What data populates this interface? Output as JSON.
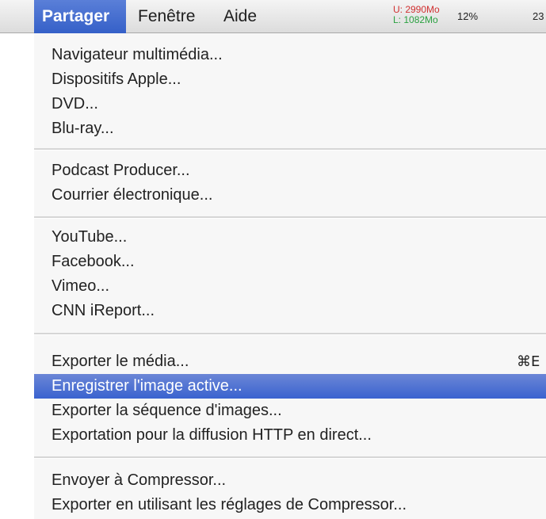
{
  "menubar": {
    "items": [
      {
        "label": "Partager",
        "active": true
      },
      {
        "label": "Fenêtre"
      },
      {
        "label": "Aide"
      }
    ],
    "memory_used": "U: 2990Mo",
    "memory_free": "L: 1082Mo",
    "cpu": "12%",
    "clipped_status": "23"
  },
  "menu": {
    "groups": [
      {
        "items": [
          {
            "label": "Navigateur multimédia..."
          },
          {
            "label": "Dispositifs Apple..."
          },
          {
            "label": "DVD..."
          },
          {
            "label": "Blu-ray..."
          }
        ]
      },
      {
        "items": [
          {
            "label": "Podcast Producer..."
          },
          {
            "label": "Courrier électronique..."
          }
        ]
      },
      {
        "items": [
          {
            "label": "YouTube..."
          },
          {
            "label": "Facebook..."
          },
          {
            "label": "Vimeo..."
          },
          {
            "label": "CNN iReport..."
          }
        ]
      },
      {
        "items": [
          {
            "label": "Exporter le média...",
            "shortcut": "⌘E"
          },
          {
            "label": "Enregistrer l'image active...",
            "highlighted": true
          },
          {
            "label": "Exporter la séquence d'images..."
          },
          {
            "label": "Exportation pour la diffusion HTTP en direct..."
          }
        ]
      },
      {
        "items": [
          {
            "label": "Envoyer à Compressor..."
          },
          {
            "label": "Exporter en utilisant les réglages de Compressor..."
          }
        ]
      }
    ]
  }
}
